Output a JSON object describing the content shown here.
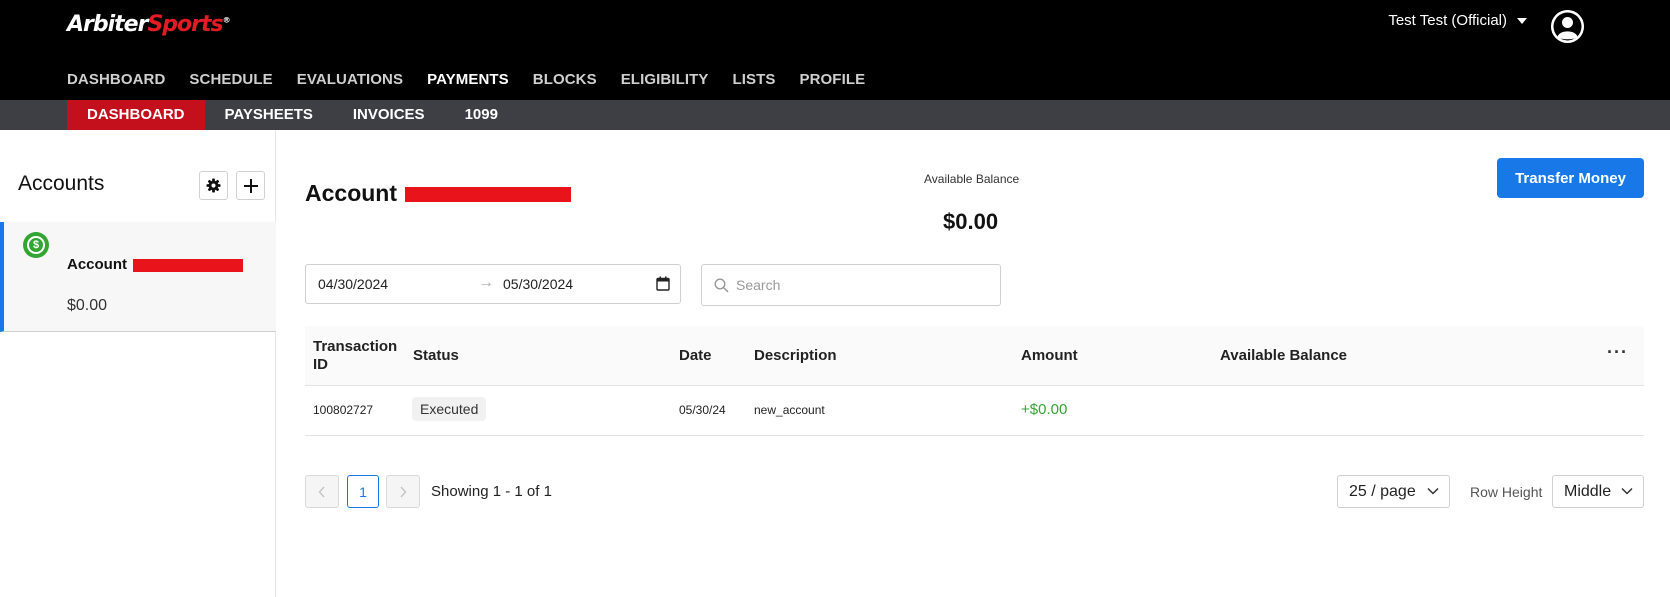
{
  "header": {
    "logo": {
      "part1": "Arbiter",
      "part2": "Sports"
    },
    "user_name": "Test Test (Official)",
    "nav": [
      {
        "label": "DASHBOARD",
        "active": false
      },
      {
        "label": "SCHEDULE",
        "active": false
      },
      {
        "label": "EVALUATIONS",
        "active": false
      },
      {
        "label": "PAYMENTS",
        "active": true
      },
      {
        "label": "BLOCKS",
        "active": false
      },
      {
        "label": "ELIGIBILITY",
        "active": false
      },
      {
        "label": "LISTS",
        "active": false
      },
      {
        "label": "PROFILE",
        "active": false
      }
    ]
  },
  "subnav": [
    {
      "label": "DASHBOARD",
      "active": true
    },
    {
      "label": "PAYSHEETS",
      "active": false
    },
    {
      "label": "INVOICES",
      "active": false
    },
    {
      "label": "1099",
      "active": false
    }
  ],
  "sidebar": {
    "title": "Accounts",
    "account": {
      "label": "Account",
      "balance": "$0.00"
    }
  },
  "main": {
    "account_title": "Account",
    "available_balance_label": "Available Balance",
    "available_balance_value": "$0.00",
    "transfer_button": "Transfer Money",
    "date_from": "04/30/2024",
    "date_to": "05/30/2024",
    "search_placeholder": "Search"
  },
  "table": {
    "columns": [
      "Transaction ID",
      "Status",
      "Date",
      "Description",
      "Amount",
      "Available Balance"
    ],
    "rows": [
      {
        "transaction_id": "100802727",
        "status": "Executed",
        "date": "05/30/24",
        "description": "new_account",
        "amount": "+$0.00",
        "available_balance": ""
      }
    ]
  },
  "pagination": {
    "current_page": "1",
    "showing": "Showing 1 - 1 of 1",
    "per_page": "25 / page",
    "row_height_label": "Row Height",
    "row_height_value": "Middle"
  },
  "colors": {
    "brand_red": "#e31b23",
    "active_tab": "#c3101c",
    "primary_blue": "#1878e8",
    "positive_green": "#33a532"
  }
}
